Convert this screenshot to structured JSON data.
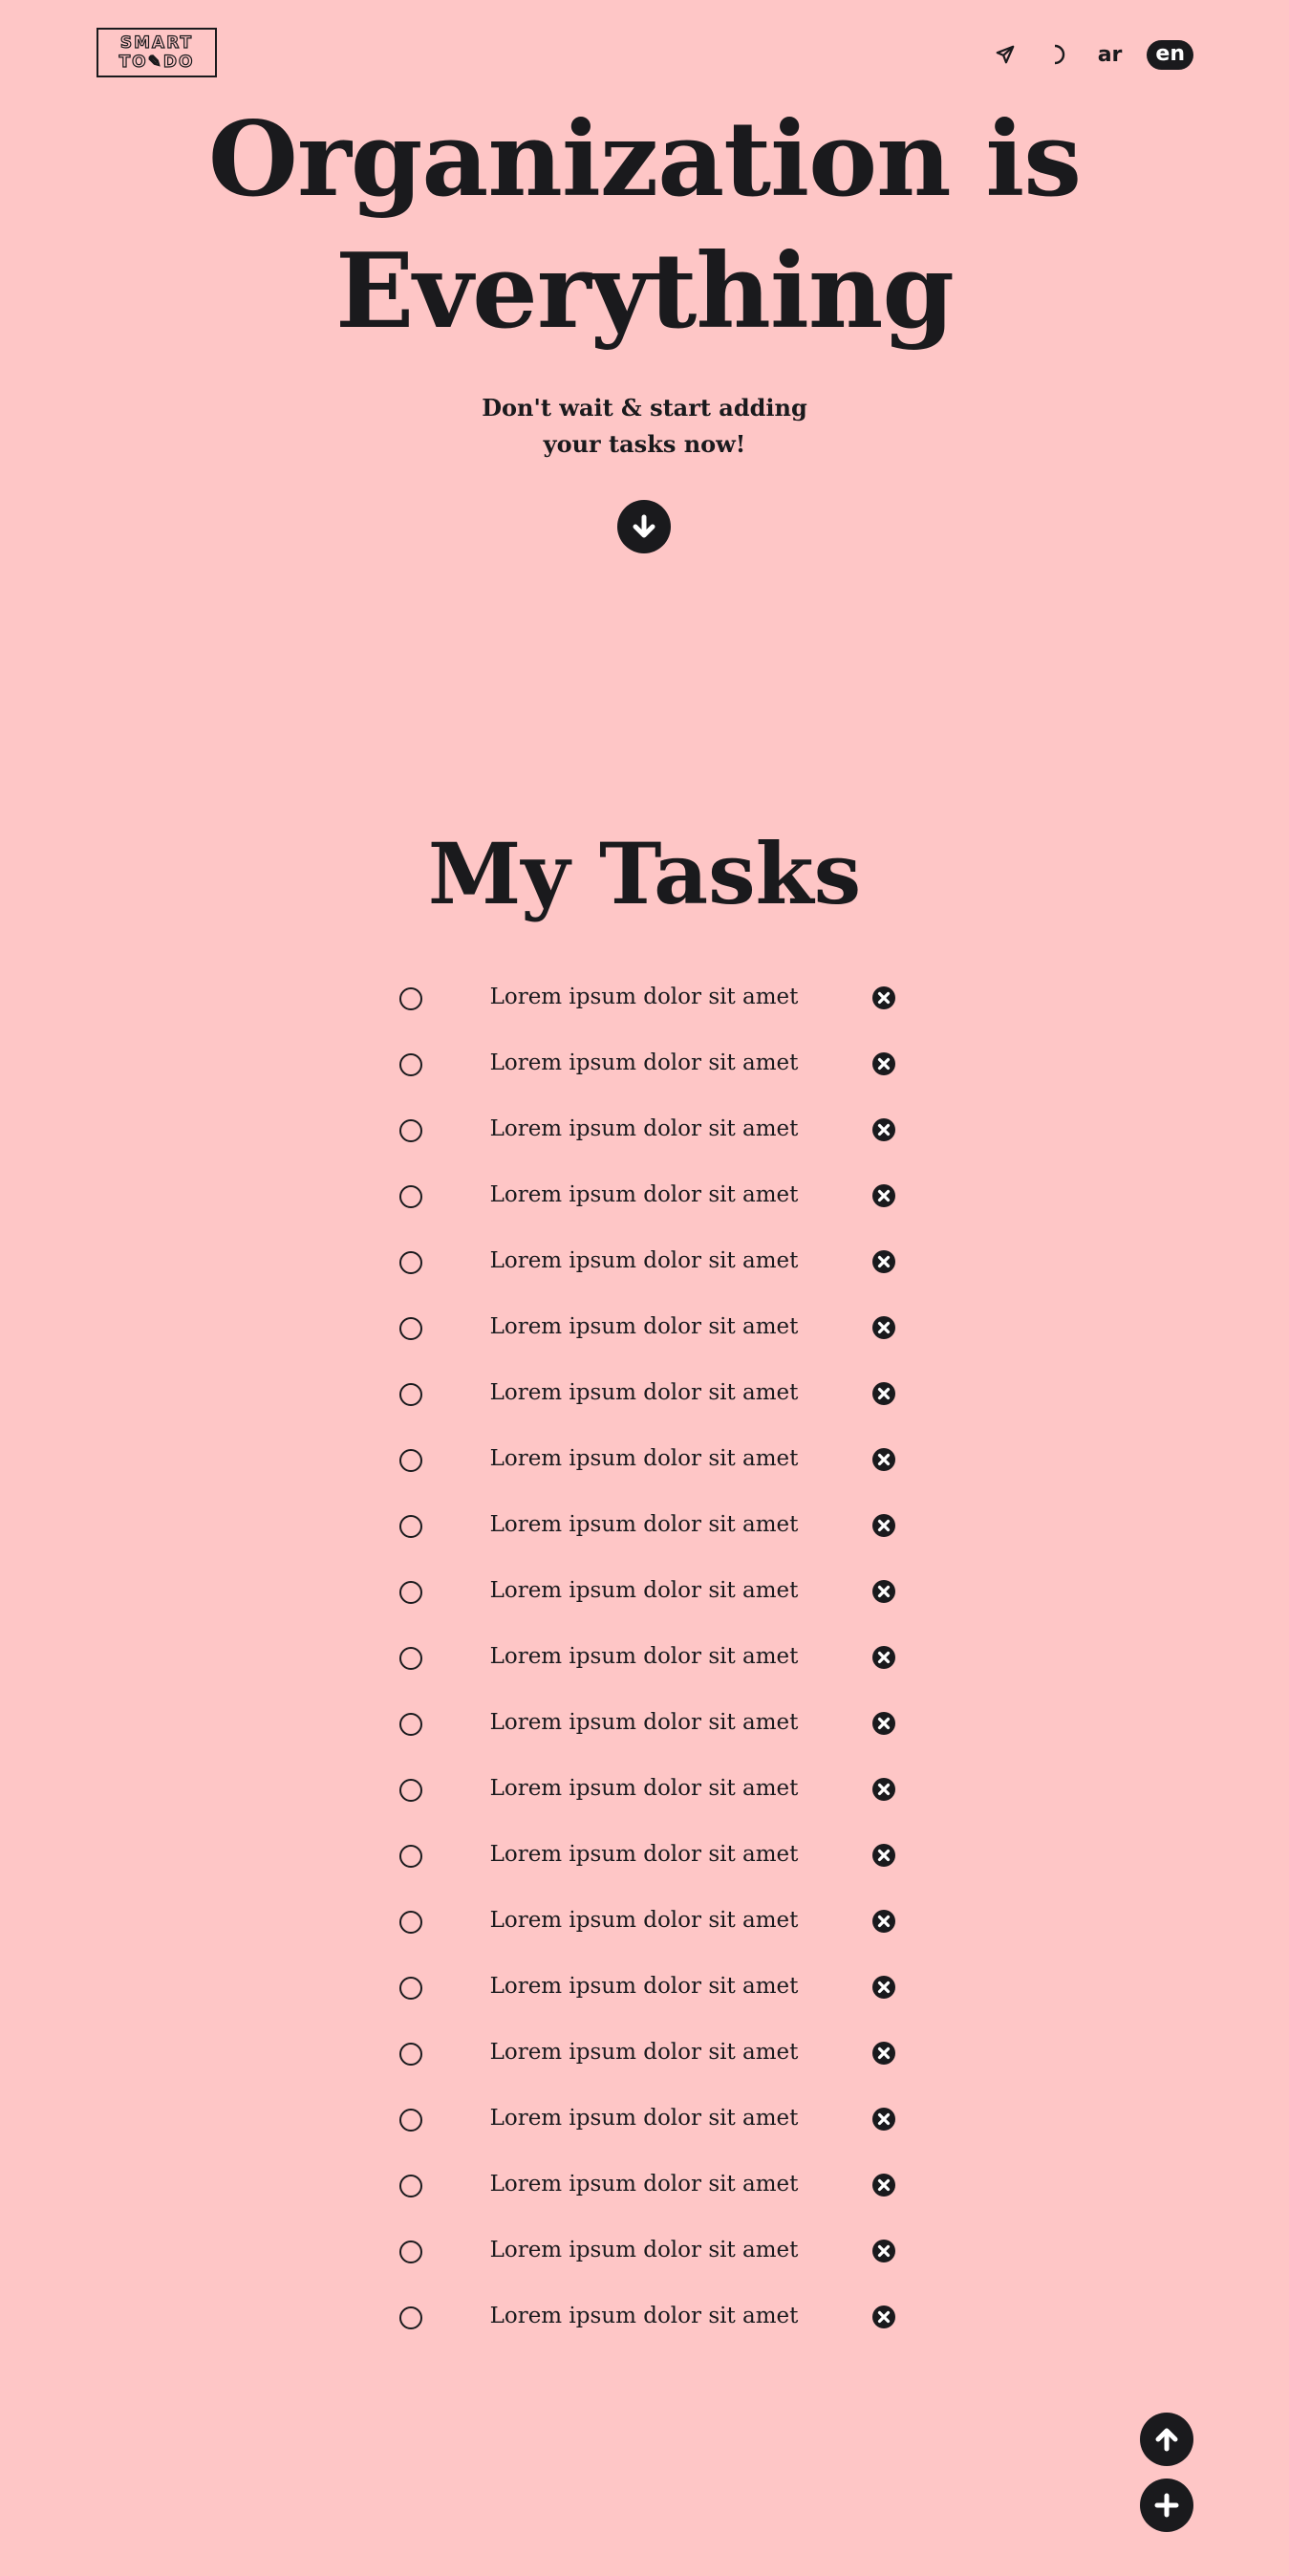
{
  "header": {
    "logo_line1": "SMART",
    "logo_line2": "TO✎DO",
    "nav_icons": [
      "send-icon",
      "moon-icon"
    ],
    "lang_ar": "ar",
    "lang_en": "en",
    "active_lang": "en"
  },
  "hero": {
    "title_line1": "Organization is",
    "title_line2": "Everything",
    "subtitle_line1": "Don't wait & start adding",
    "subtitle_line2": "your tasks now!",
    "scroll_icon": "arrow-down-icon"
  },
  "tasks": {
    "title": "My Tasks",
    "items": [
      {
        "text": "Lorem ipsum dolor sit amet",
        "done": false
      },
      {
        "text": "Lorem ipsum dolor sit amet",
        "done": false
      },
      {
        "text": "Lorem ipsum dolor sit amet",
        "done": false
      },
      {
        "text": "Lorem ipsum dolor sit amet",
        "done": false
      },
      {
        "text": "Lorem ipsum dolor sit amet",
        "done": false
      },
      {
        "text": "Lorem ipsum dolor sit amet",
        "done": false
      },
      {
        "text": "Lorem ipsum dolor sit amet",
        "done": false
      },
      {
        "text": "Lorem ipsum dolor sit amet",
        "done": false
      },
      {
        "text": "Lorem ipsum dolor sit amet",
        "done": false
      },
      {
        "text": "Lorem ipsum dolor sit amet",
        "done": false
      },
      {
        "text": "Lorem ipsum dolor sit amet",
        "done": false
      },
      {
        "text": "Lorem ipsum dolor sit amet",
        "done": false
      },
      {
        "text": "Lorem ipsum dolor sit amet",
        "done": false
      },
      {
        "text": "Lorem ipsum dolor sit amet",
        "done": false
      },
      {
        "text": "Lorem ipsum dolor sit amet",
        "done": false
      },
      {
        "text": "Lorem ipsum dolor sit amet",
        "done": false
      },
      {
        "text": "Lorem ipsum dolor sit amet",
        "done": false
      },
      {
        "text": "Lorem ipsum dolor sit amet",
        "done": false
      },
      {
        "text": "Lorem ipsum dolor sit amet",
        "done": false
      },
      {
        "text": "Lorem ipsum dolor sit amet",
        "done": false
      },
      {
        "text": "Lorem ipsum dolor sit amet",
        "done": false
      }
    ]
  },
  "floating": {
    "scroll_top_icon": "arrow-up-icon",
    "add_icon": "plus-icon"
  },
  "colors": {
    "background": "#fec6c6",
    "ink": "#1a1a1d",
    "on_ink": "#ffffff"
  }
}
